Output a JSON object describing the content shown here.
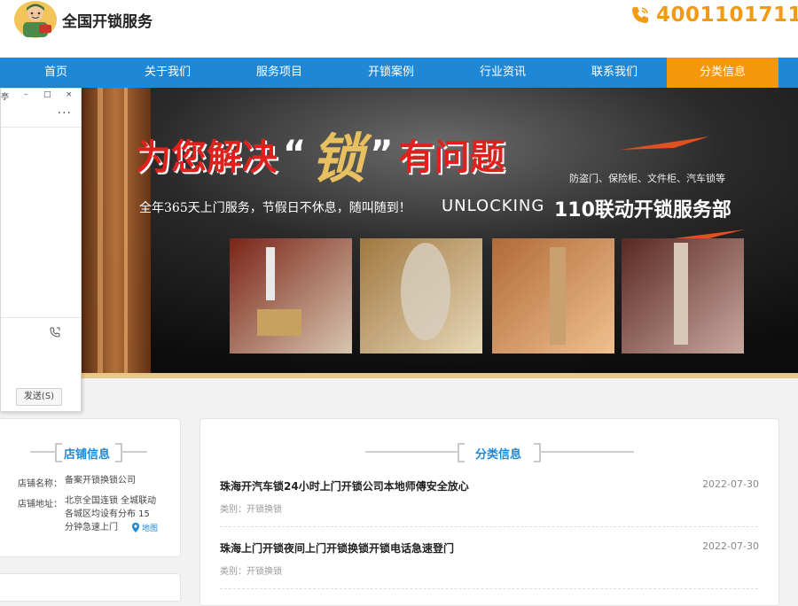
{
  "header": {
    "site_title": "全国开锁服务",
    "phone": "4001101711"
  },
  "nav": {
    "items": [
      "首页",
      "关于我们",
      "服务项目",
      "开锁案例",
      "行业资讯",
      "联系我们",
      "分类信息"
    ],
    "active_index": 6
  },
  "banner": {
    "headline_part1": "为您解决",
    "headline_key": "锁",
    "headline_part2": "有问题",
    "open_quote": "“",
    "close_quote": "”",
    "subtitle": "全年365天上门服务，节假日不休息，随叫随到！",
    "unlocking": "UNLOCKING",
    "brand": "110联动开锁服务部",
    "categories": "防盗门、保险柜、文件柜、汽车锁等"
  },
  "chat_window": {
    "title_fragment": "亭",
    "more": "···",
    "send_button": "发送(S)"
  },
  "shop_info": {
    "title": "店铺信息",
    "name_label": "店铺名称：",
    "name_value": "备案开锁换锁公司",
    "address_label": "店铺地址：",
    "address_line1": "北京全国连锁 全城联动",
    "address_line2": "各城区均设有分布 15",
    "address_line3": "分钟急速上门",
    "map_link": "地图"
  },
  "classified": {
    "title": "分类信息",
    "items": [
      {
        "title": "珠海开汽车锁24小时上门开锁公司本地师傅安全放心",
        "date": "2022-07-30",
        "category": "类别：开锁换锁"
      },
      {
        "title": "珠海上门开锁夜间上门开锁换锁开锁电话急速登门",
        "date": "2022-07-30",
        "category": "类别：开锁换锁"
      }
    ]
  },
  "colors": {
    "nav_blue": "#1e88d6",
    "accent_orange": "#f6960b",
    "phone_orange": "#f29a11"
  }
}
